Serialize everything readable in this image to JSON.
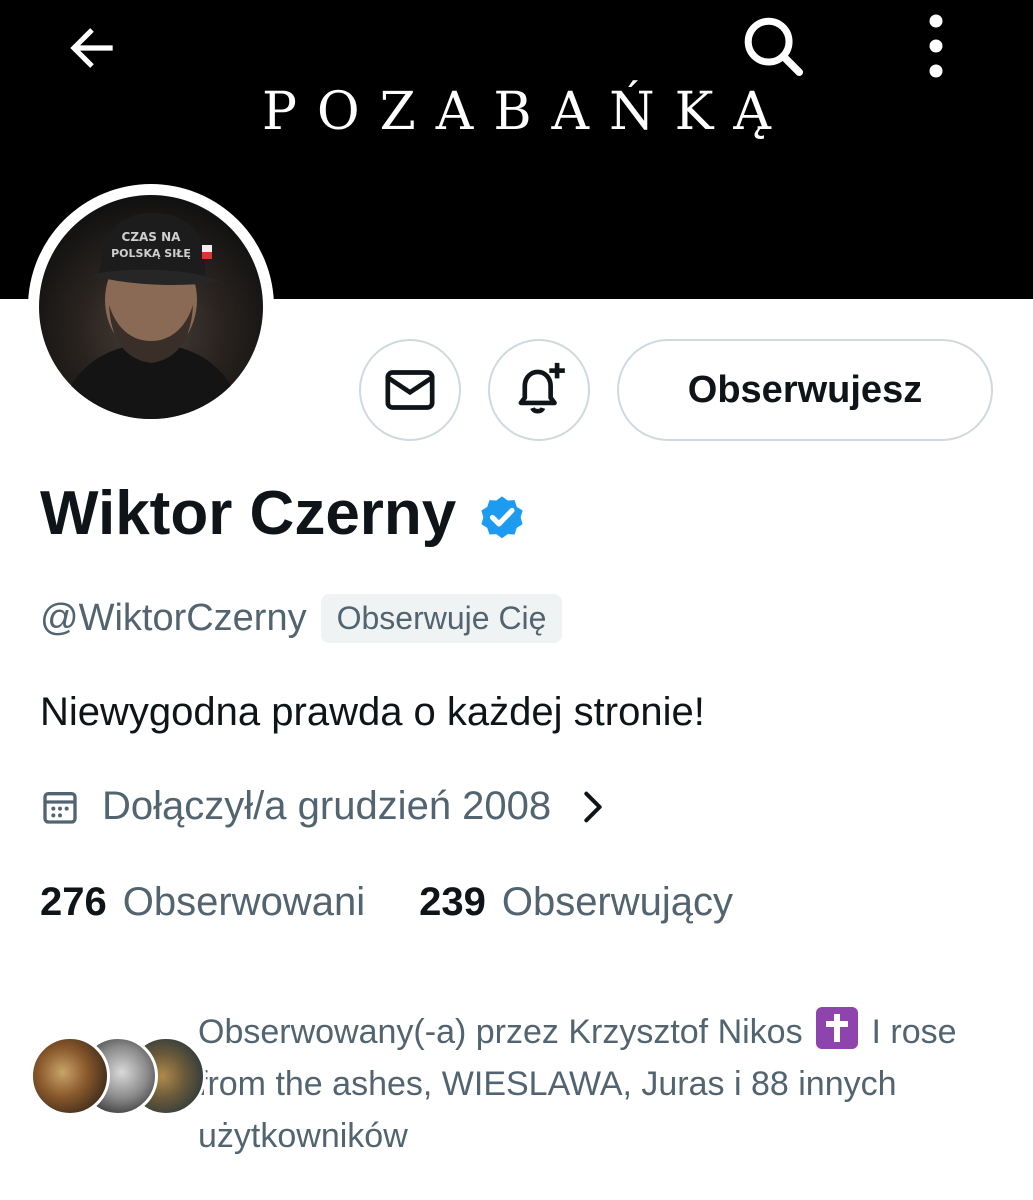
{
  "banner": {
    "text": "POZABAŃKĄ"
  },
  "header": {
    "back_icon": "arrow-left-icon",
    "search_icon": "search-icon",
    "more_icon": "more-vertical-icon"
  },
  "avatar": {
    "cap_line1": "CZAS NA",
    "cap_line2": "POLSKĄ SIŁĘ"
  },
  "actions": {
    "message_icon": "envelope-icon",
    "notify_icon": "bell-plus-icon",
    "follow_label": "Obserwujesz"
  },
  "profile": {
    "name": "Wiktor Czerny",
    "verified_color": "#1d9bf0",
    "handle": "@WiktorCzerny",
    "follows_you": "Obserwuje Cię",
    "bio": "Niewygodna prawda o każdej stronie!",
    "joined": "Dołączył/a grudzień 2008"
  },
  "stats": {
    "following_count": "276",
    "following_label": "Obserwowani",
    "followers_count": "239",
    "followers_label": "Obserwujący"
  },
  "followed_by": {
    "part1": "Obserwowany(-a) przez Krzysztof Nikos",
    "part2": "I rose from the ashes, WIESLAWA, Juras i 88 innych użytkowników"
  }
}
